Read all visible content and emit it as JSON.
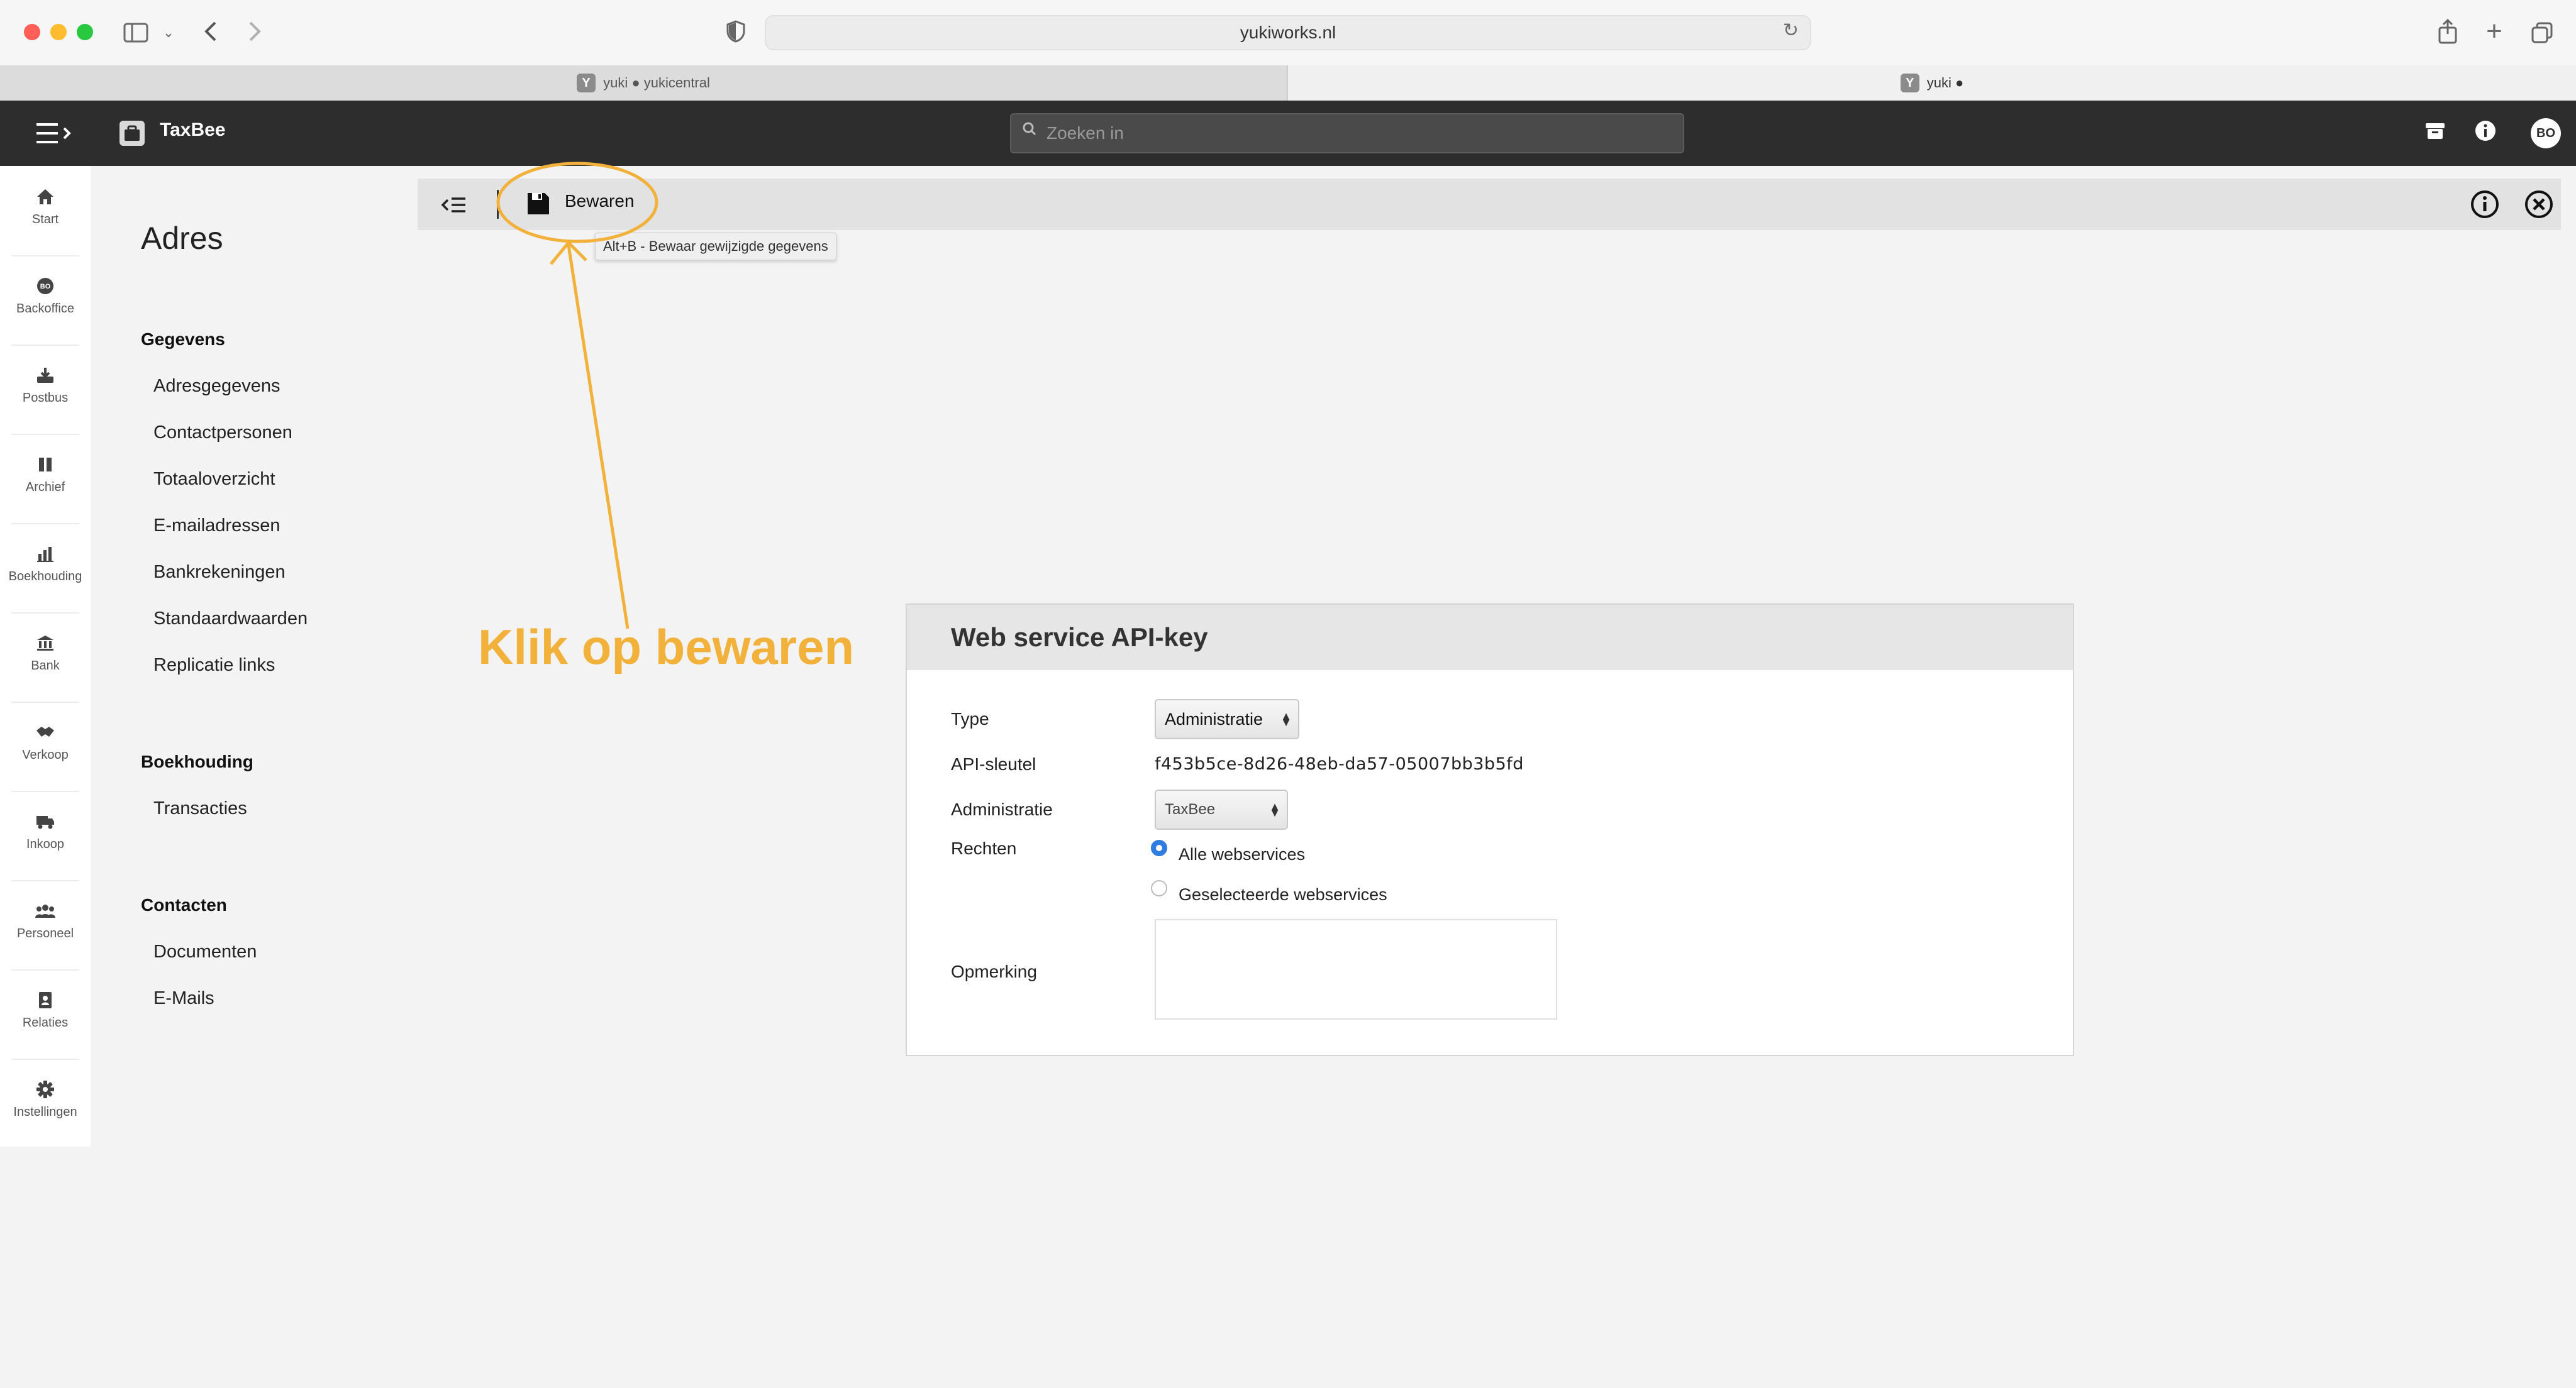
{
  "browser": {
    "url": "yukiworks.nl",
    "tabs": [
      {
        "favicon": "Y",
        "title": "yuki ● yukicentral"
      },
      {
        "favicon": "Y",
        "title": "yuki ●"
      }
    ]
  },
  "header": {
    "app_name": "TaxBee",
    "search_placeholder": "Zoeken in",
    "avatar": "BO"
  },
  "app_nav": [
    {
      "label": "Start",
      "icon": "home-icon"
    },
    {
      "label": "Backoffice",
      "icon": "backoffice-icon"
    },
    {
      "label": "Postbus",
      "icon": "inbox-icon"
    },
    {
      "label": "Archief",
      "icon": "archive-icon"
    },
    {
      "label": "Boekhouding",
      "icon": "chart-icon"
    },
    {
      "label": "Bank",
      "icon": "bank-icon"
    },
    {
      "label": "Verkoop",
      "icon": "handshake-icon"
    },
    {
      "label": "Inkoop",
      "icon": "truck-icon"
    },
    {
      "label": "Personeel",
      "icon": "people-icon"
    },
    {
      "label": "Relaties",
      "icon": "contacts-icon"
    },
    {
      "label": "Instellingen",
      "icon": "gear-icon"
    }
  ],
  "page": {
    "title": "Adres",
    "sections": [
      {
        "title": "Gegevens",
        "links": [
          "Adresgegevens",
          "Contactpersonen",
          "Totaaloverzicht",
          "E-mailadressen",
          "Bankrekeningen",
          "Standaardwaarden",
          "Replicatie links"
        ]
      },
      {
        "title": "Boekhouding",
        "links": [
          "Transacties"
        ]
      },
      {
        "title": "Contacten",
        "links": [
          "Documenten",
          "E-Mails"
        ]
      }
    ]
  },
  "toolbar": {
    "save_label": "Bewaren",
    "save_tooltip": "Alt+B - Bewaar gewijzigde gegevens"
  },
  "annotation": {
    "text": "Klik op bewaren",
    "color": "#f2b13a"
  },
  "card": {
    "title": "Web service API-key",
    "fields": {
      "type_label": "Type",
      "type_value": "Administratie",
      "api_key_label": "API-sleutel",
      "api_key_value": "f453b5ce-8d26-48eb-da57-05007bb3b5fd",
      "administratie_label": "Administratie",
      "administratie_value": "TaxBee",
      "rechten_label": "Rechten",
      "rechten_options": [
        "Alle webservices",
        "Geselecteerde webservices"
      ],
      "rechten_selected": "Alle webservices",
      "opmerking_label": "Opmerking",
      "opmerking_value": ""
    }
  }
}
